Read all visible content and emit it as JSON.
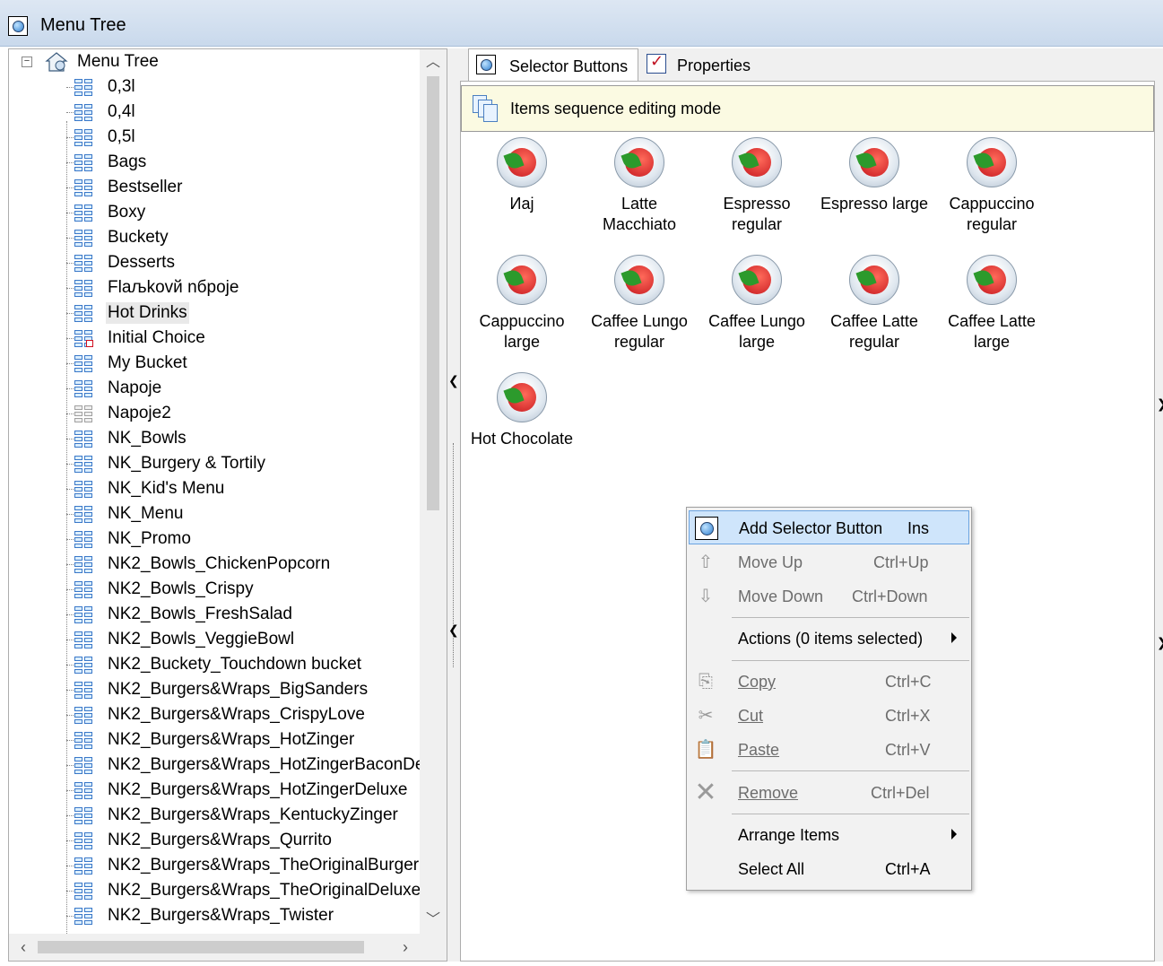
{
  "window": {
    "title": "Menu Tree"
  },
  "tree": {
    "root_label": "Menu Tree",
    "items": [
      "0,3l",
      "0,4l",
      "0,5l",
      "Bags",
      "Bestseller",
      "Boxy",
      "Buckety",
      "Desserts",
      "Flaљkovй nбpoje",
      "Hot Drinks",
      "Initial Choice",
      "My Bucket",
      "Napoje",
      "Napoje2",
      "NK_Bowls",
      "NK_Burgery & Tortily",
      "NK_Kid's Menu",
      "NK_Menu",
      "NK_Promo",
      "NK2_Bowls_ChickenPopcorn",
      "NK2_Bowls_Crispy",
      "NK2_Bowls_FreshSalad",
      "NK2_Bowls_VeggieBowl",
      "NK2_Buckety_Touchdown bucket",
      "NK2_Burgers&Wraps_BigSanders",
      "NK2_Burgers&Wraps_CrispyLove",
      "NK2_Burgers&Wraps_HotZinger",
      "NK2_Burgers&Wraps_HotZingerBaconDe",
      "NK2_Burgers&Wraps_HotZingerDeluxe",
      "NK2_Burgers&Wraps_KentuckyZinger",
      "NK2_Burgers&Wraps_Qurrito",
      "NK2_Burgers&Wraps_TheOriginalBurger",
      "NK2_Burgers&Wraps_TheOriginalDeluxe",
      "NK2_Burgers&Wraps_Twister"
    ],
    "selected": "Hot Drinks"
  },
  "tabs": {
    "selector_buttons": "Selector Buttons",
    "properties": "Properties"
  },
  "banner": {
    "text": "Items sequence editing mode"
  },
  "items": [
    {
      "label": "Иaj"
    },
    {
      "label": "Latte Macchiato"
    },
    {
      "label": "Espresso regular"
    },
    {
      "label": "Espresso large"
    },
    {
      "label": "Cappuccino regular"
    },
    {
      "label": "Cappuccino large"
    },
    {
      "label": "Caffee Lungo regular"
    },
    {
      "label": "Caffee Lungo large"
    },
    {
      "label": "Caffee Latte regular"
    },
    {
      "label": "Caffee Latte large"
    },
    {
      "label": "Hot Chocolate"
    }
  ],
  "context_menu": {
    "add_selector_button": {
      "label": "Add Selector Button",
      "shortcut": "Ins"
    },
    "move_up": {
      "label": "Move Up",
      "shortcut": "Ctrl+Up"
    },
    "move_down": {
      "label": "Move Down",
      "shortcut": "Ctrl+Down"
    },
    "actions": {
      "label": "Actions (0 items selected)"
    },
    "copy": {
      "label": "Copy",
      "shortcut": "Ctrl+C"
    },
    "cut": {
      "label": "Cut",
      "shortcut": "Ctrl+X"
    },
    "paste": {
      "label": "Paste",
      "shortcut": "Ctrl+V"
    },
    "remove": {
      "label": "Remove",
      "shortcut": "Ctrl+Del"
    },
    "arrange_items": {
      "label": "Arrange Items"
    },
    "select_all": {
      "label": "Select All",
      "shortcut": "Ctrl+A"
    }
  },
  "colors": {
    "accent": "#cfe5fb",
    "banner": "#fbfae2",
    "titlebar": "#c9d9ec"
  },
  "icons": {
    "tree_node": "grid-icon",
    "root": "home-icon",
    "window": "globe-icon"
  }
}
